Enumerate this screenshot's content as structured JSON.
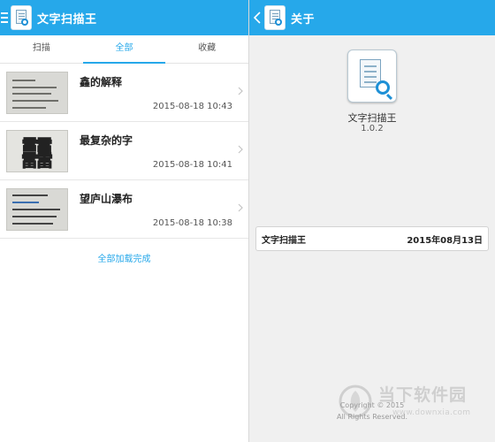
{
  "left": {
    "title": "文字扫描王",
    "tabs": [
      {
        "label": "扫描",
        "active": false
      },
      {
        "label": "全部",
        "active": true
      },
      {
        "label": "收藏",
        "active": false
      }
    ],
    "items": [
      {
        "name": "鑫的解释",
        "time": "2015-08-18 10:43"
      },
      {
        "name": "最复杂的字",
        "time": "2015-08-18 10:41",
        "thumb_char": "䨻"
      },
      {
        "name": "望庐山瀑布",
        "time": "2015-08-18 10:38"
      }
    ],
    "loaded_text": "全部加载完成"
  },
  "right": {
    "title": "关于",
    "app_name": "文字扫描王",
    "version": "1.0.2",
    "info_label": "文字扫描王",
    "info_date": "2015年08月13日",
    "copyright": [
      "Copyright © 2015",
      "All Rights Reserved."
    ]
  },
  "watermark": {
    "cn": "当下软件园",
    "en": "www.downxia.com"
  },
  "colors": {
    "accent": "#26a8ea"
  }
}
